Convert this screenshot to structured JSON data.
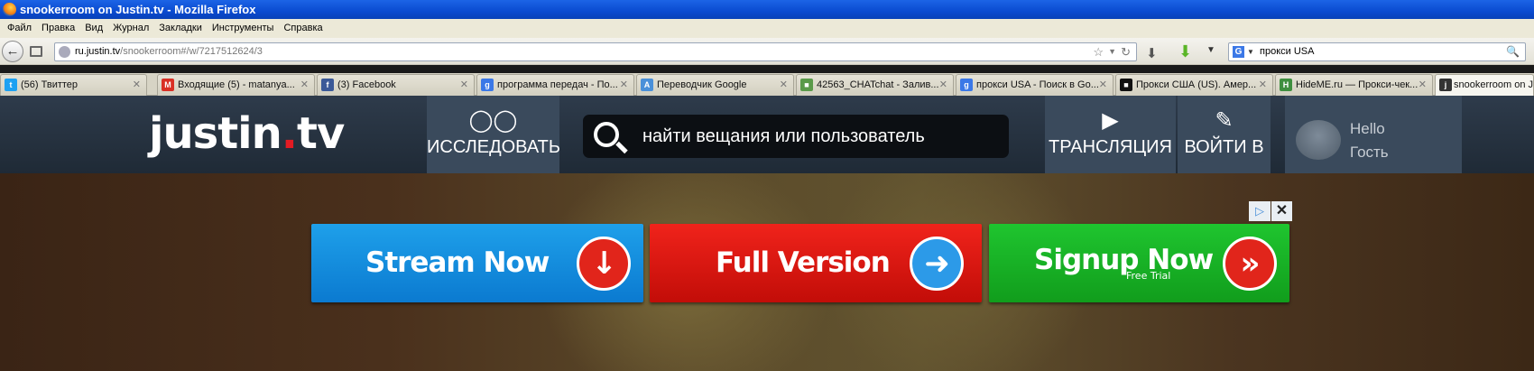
{
  "window": {
    "title": "snookerroom on Justin.tv - Mozilla Firefox"
  },
  "menu": [
    "Файл",
    "Правка",
    "Вид",
    "Журнал",
    "Закладки",
    "Инструменты",
    "Справка"
  ],
  "url": {
    "domain": "ru.justin.tv",
    "path": "/snookerroom#/w/7217512624/3"
  },
  "search": {
    "value": "прокси USA",
    "engine_icon": "G"
  },
  "tabs": [
    {
      "label": "(56) Твиттер",
      "icon": "twitter-icon",
      "color": "#1da1f2"
    },
    {
      "label": "Входящие (5) - matanya...",
      "icon": "gmail-icon",
      "color": "#d93025"
    },
    {
      "label": "(3) Facebook",
      "icon": "facebook-icon",
      "color": "#3b5998"
    },
    {
      "label": "программа передач - По...",
      "icon": "google-icon",
      "color": "#3b78e7"
    },
    {
      "label": "Переводчик Google",
      "icon": "translate-icon",
      "color": "#4a90d9"
    },
    {
      "label": "42563_CHATchat - Залив...",
      "icon": "site-icon",
      "color": "#5a9a4a"
    },
    {
      "label": "прокси USA - Поиск в Go...",
      "icon": "google-icon",
      "color": "#3b78e7"
    },
    {
      "label": "Прокси США (US). Амер...",
      "icon": "proxy-icon",
      "color": "#111111"
    },
    {
      "label": "HideME.ru — Прокси-чек...",
      "icon": "hideme-icon",
      "color": "#3f8f3f"
    },
    {
      "label": "snookerroom on Ju",
      "icon": "jtv-icon",
      "color": "#333333"
    }
  ],
  "jtv": {
    "logo_main": "justin",
    "logo_dot": ".",
    "logo_tld": "tv",
    "explore": "ИССЛЕДОВАТЬ",
    "search_placeholder": "найти вещания или пользователь",
    "broadcast": "ТРАНСЛЯЦИЯ",
    "login": "ВОЙТИ В",
    "hello": "Hello",
    "guest": "Гость"
  },
  "ads": {
    "stream": "Stream Now",
    "full": "Full Version",
    "signup": "Signup Now",
    "signup_sub": "Free Trial"
  },
  "colors": {
    "blue": "#0b7ad0",
    "red": "#c20d08",
    "green": "#119d1c",
    "header": "#1f2a36"
  }
}
